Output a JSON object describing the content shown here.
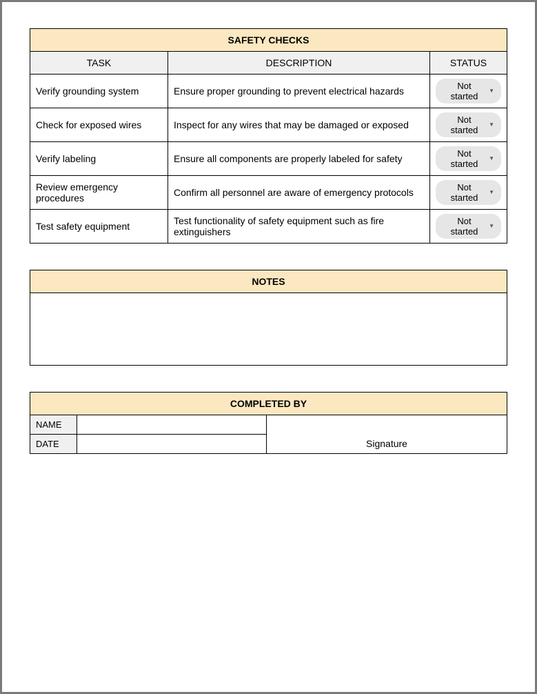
{
  "safety_checks": {
    "title": "SAFETY CHECKS",
    "headers": {
      "task": "TASK",
      "description": "DESCRIPTION",
      "status": "STATUS"
    },
    "rows": [
      {
        "task": "Verify grounding system",
        "description": "Ensure proper grounding to prevent electrical hazards",
        "status": "Not started"
      },
      {
        "task": "Check for exposed wires",
        "description": "Inspect for any wires that may be damaged or exposed",
        "status": "Not started"
      },
      {
        "task": "Verify labeling",
        "description": "Ensure all components are properly labeled for safety",
        "status": "Not started"
      },
      {
        "task": "Review emergency procedures",
        "description": "Confirm all personnel are aware of emergency protocols",
        "status": "Not started"
      },
      {
        "task": "Test safety equipment",
        "description": "Test functionality of safety equipment such as fire extinguishers",
        "status": "Not started"
      }
    ]
  },
  "notes": {
    "title": "NOTES",
    "body": ""
  },
  "completed_by": {
    "title": "COMPLETED BY",
    "name_label": "NAME",
    "date_label": "DATE",
    "name_value": "",
    "date_value": "",
    "signature_label": "Signature"
  }
}
